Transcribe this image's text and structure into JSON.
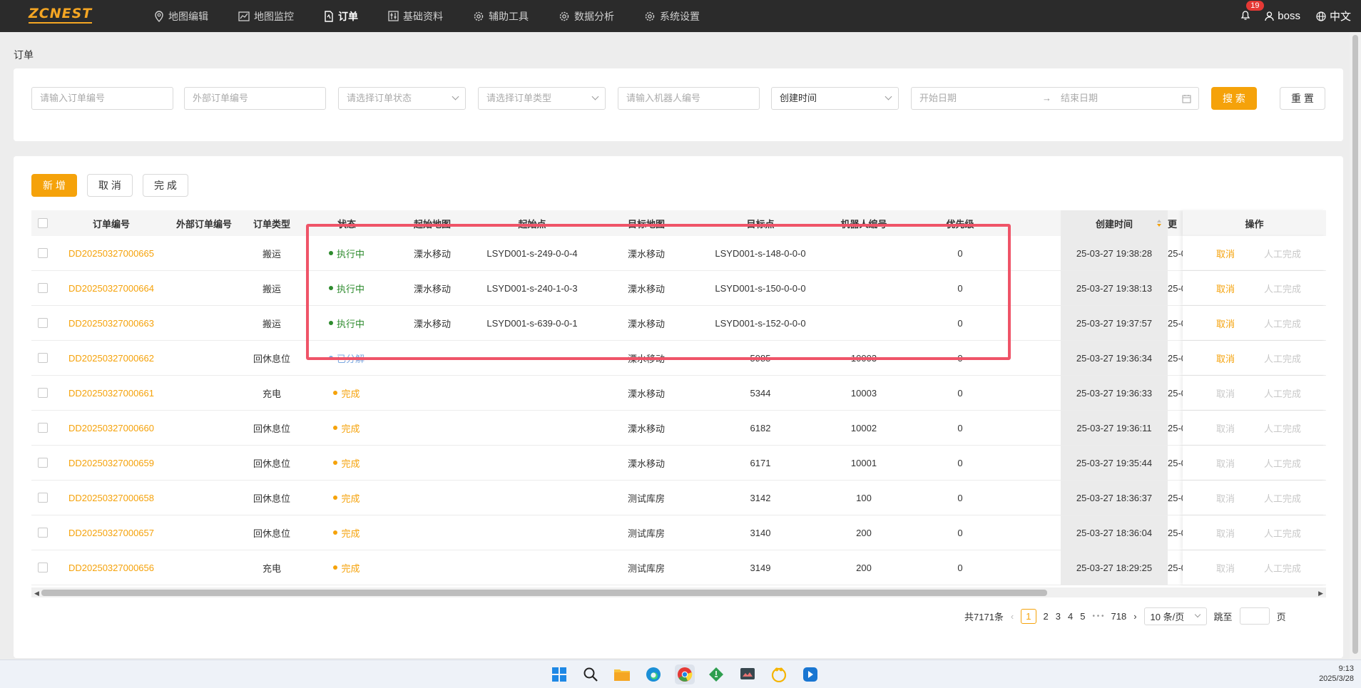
{
  "app": {
    "logo": "ZCNEST"
  },
  "nav": [
    {
      "label": "地图编辑",
      "icon": "map-pin-icon"
    },
    {
      "label": "地图监控",
      "icon": "monitor-chart-icon"
    },
    {
      "label": "订单",
      "icon": "document-icon",
      "active": true
    },
    {
      "label": "基础资料",
      "icon": "sliders-icon"
    },
    {
      "label": "辅助工具",
      "icon": "gear-icon"
    },
    {
      "label": "数据分析",
      "icon": "gear-icon"
    },
    {
      "label": "系统设置",
      "icon": "gear-icon"
    }
  ],
  "header": {
    "badge": "19",
    "user": "boss",
    "language": "中文"
  },
  "page": {
    "title": "订单"
  },
  "filters": {
    "order_no_placeholder": "请输入订单编号",
    "ext_order_no_placeholder": "外部订单编号",
    "status_placeholder": "请选择订单状态",
    "type_placeholder": "请选择订单类型",
    "robot_placeholder": "请输入机器人编号",
    "time_field": "创建时间",
    "start_date": "开始日期",
    "end_date": "结束日期",
    "range_arrow": "→",
    "search": "搜 索",
    "reset": "重 置"
  },
  "actions": {
    "add": "新 增",
    "cancel": "取 消",
    "done": "完 成"
  },
  "table": {
    "headers": [
      "订单编号",
      "外部订单编号",
      "订单类型",
      "状态",
      "起始地图",
      "起始点",
      "目标地图",
      "目标点",
      "机器人编号",
      "优先级",
      "创建时间",
      "更",
      "操作"
    ],
    "rows": [
      {
        "id": "DD20250327000665",
        "ext": "",
        "type": "搬运",
        "status": "执行中",
        "status_kind": "running",
        "src_map": "溧水移动",
        "src_pt": "LSYD001-s-249-0-0-4",
        "dst_map": "溧水移动",
        "dst_pt": "LSYD001-s-148-0-0-0",
        "robot": "",
        "priority": "0",
        "created": "25-03-27 19:38:28",
        "updated": "25-0",
        "op_cancel": "取消",
        "op_manual": "人工完成",
        "cancel_enabled": true
      },
      {
        "id": "DD20250327000664",
        "ext": "",
        "type": "搬运",
        "status": "执行中",
        "status_kind": "running",
        "src_map": "溧水移动",
        "src_pt": "LSYD001-s-240-1-0-3",
        "dst_map": "溧水移动",
        "dst_pt": "LSYD001-s-150-0-0-0",
        "robot": "",
        "priority": "0",
        "created": "25-03-27 19:38:13",
        "updated": "25-0",
        "op_cancel": "取消",
        "op_manual": "人工完成",
        "cancel_enabled": true
      },
      {
        "id": "DD20250327000663",
        "ext": "",
        "type": "搬运",
        "status": "执行中",
        "status_kind": "running",
        "src_map": "溧水移动",
        "src_pt": "LSYD001-s-639-0-0-1",
        "dst_map": "溧水移动",
        "dst_pt": "LSYD001-s-152-0-0-0",
        "robot": "",
        "priority": "0",
        "created": "25-03-27 19:37:57",
        "updated": "25-0",
        "op_cancel": "取消",
        "op_manual": "人工完成",
        "cancel_enabled": true
      },
      {
        "id": "DD20250327000662",
        "ext": "",
        "type": "回休息位",
        "status": "已分解",
        "status_kind": "split",
        "src_map": "",
        "src_pt": "",
        "dst_map": "溧水移动",
        "dst_pt": "5985",
        "robot": "10003",
        "priority": "0",
        "created": "25-03-27 19:36:34",
        "updated": "25-0",
        "op_cancel": "取消",
        "op_manual": "人工完成",
        "cancel_enabled": true
      },
      {
        "id": "DD20250327000661",
        "ext": "",
        "type": "充电",
        "status": "完成",
        "status_kind": "done",
        "src_map": "",
        "src_pt": "",
        "dst_map": "溧水移动",
        "dst_pt": "5344",
        "robot": "10003",
        "priority": "0",
        "created": "25-03-27 19:36:33",
        "updated": "25-0",
        "op_cancel": "取消",
        "op_manual": "人工完成",
        "cancel_enabled": false
      },
      {
        "id": "DD20250327000660",
        "ext": "",
        "type": "回休息位",
        "status": "完成",
        "status_kind": "done",
        "src_map": "",
        "src_pt": "",
        "dst_map": "溧水移动",
        "dst_pt": "6182",
        "robot": "10002",
        "priority": "0",
        "created": "25-03-27 19:36:11",
        "updated": "25-0",
        "op_cancel": "取消",
        "op_manual": "人工完成",
        "cancel_enabled": false
      },
      {
        "id": "DD20250327000659",
        "ext": "",
        "type": "回休息位",
        "status": "完成",
        "status_kind": "done",
        "src_map": "",
        "src_pt": "",
        "dst_map": "溧水移动",
        "dst_pt": "6171",
        "robot": "10001",
        "priority": "0",
        "created": "25-03-27 19:35:44",
        "updated": "25-0",
        "op_cancel": "取消",
        "op_manual": "人工完成",
        "cancel_enabled": false
      },
      {
        "id": "DD20250327000658",
        "ext": "",
        "type": "回休息位",
        "status": "完成",
        "status_kind": "done",
        "src_map": "",
        "src_pt": "",
        "dst_map": "测试库房",
        "dst_pt": "3142",
        "robot": "100",
        "priority": "0",
        "created": "25-03-27 18:36:37",
        "updated": "25-0",
        "op_cancel": "取消",
        "op_manual": "人工完成",
        "cancel_enabled": false
      },
      {
        "id": "DD20250327000657",
        "ext": "",
        "type": "回休息位",
        "status": "完成",
        "status_kind": "done",
        "src_map": "",
        "src_pt": "",
        "dst_map": "测试库房",
        "dst_pt": "3140",
        "robot": "200",
        "priority": "0",
        "created": "25-03-27 18:36:04",
        "updated": "25-0",
        "op_cancel": "取消",
        "op_manual": "人工完成",
        "cancel_enabled": false
      },
      {
        "id": "DD20250327000656",
        "ext": "",
        "type": "充电",
        "status": "完成",
        "status_kind": "done",
        "src_map": "",
        "src_pt": "",
        "dst_map": "测试库房",
        "dst_pt": "3149",
        "robot": "200",
        "priority": "0",
        "created": "25-03-27 18:29:25",
        "updated": "25-0",
        "op_cancel": "取消",
        "op_manual": "人工完成",
        "cancel_enabled": false
      }
    ]
  },
  "pagination": {
    "total": "共7171条",
    "prev": "‹",
    "pages": [
      "1",
      "2",
      "3",
      "4",
      "5"
    ],
    "ellipsis": "• • •",
    "last": "718",
    "next": "›",
    "page_size": "10 条/页",
    "jump_label": "跳至",
    "page_suffix": "页"
  },
  "colors": {
    "accent": "#f5a20a",
    "running": "#2e8b2e",
    "done": "#f5a20a",
    "highlight": "#ef5468"
  },
  "taskbar": {
    "time": "9:13",
    "date": "2025/3/28"
  }
}
